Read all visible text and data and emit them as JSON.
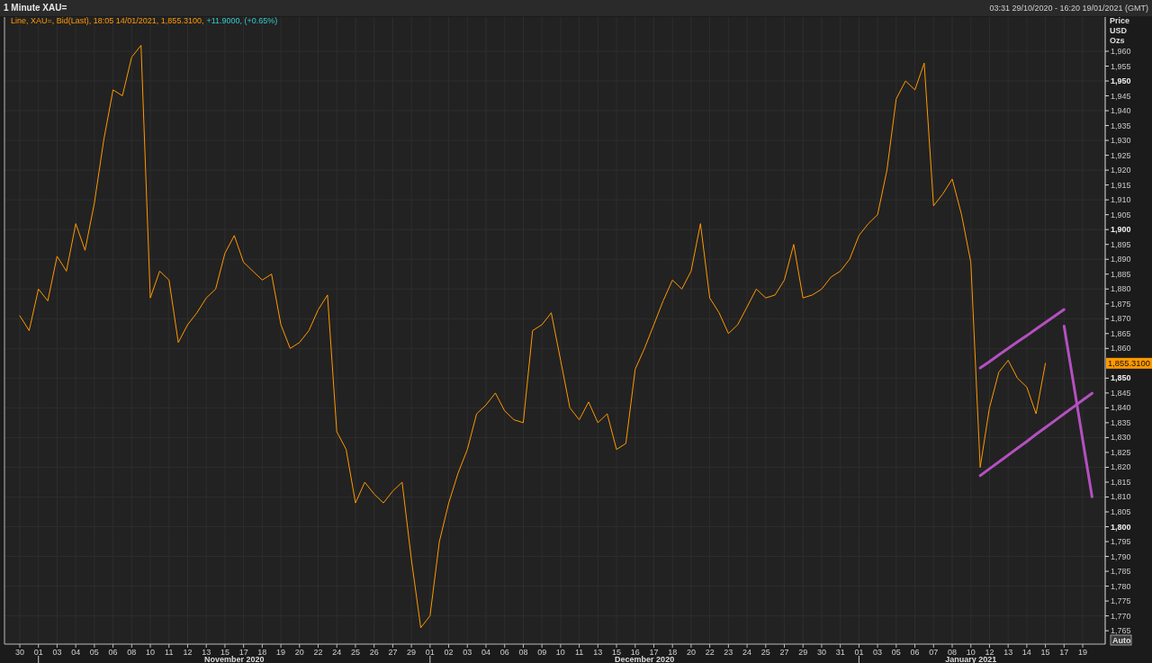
{
  "window": {
    "title": "1 Minute XAU=",
    "range": "03:31 29/10/2020 - 16:20 19/01/2021 (GMT)"
  },
  "chart": {
    "legend": {
      "text": "Line, XAU=, Bid(Last), 18:05 14/01/2021, 1,855.3100,",
      "change": "+11.9000, (+0.65%)"
    },
    "axis_header": [
      "Price",
      "USD",
      "Ozs"
    ],
    "last_price_tag": "1,855.3100",
    "months": [
      "November 2020",
      "December 2020",
      "January 2021"
    ],
    "auto_button": "Auto",
    "chart_data": {
      "type": "line",
      "ylim": [
        1760.5,
        1971.5
      ],
      "grid": true,
      "categories": [
        "30",
        null,
        "01",
        null,
        "03",
        null,
        "04",
        null,
        "05",
        null,
        "06",
        null,
        "08",
        null,
        "10",
        null,
        "11",
        null,
        "12",
        null,
        "13",
        null,
        "15",
        null,
        "17",
        null,
        "18",
        null,
        "19",
        null,
        "20",
        null,
        "22",
        null,
        "24",
        null,
        "25",
        null,
        "26",
        null,
        "27",
        null,
        "29",
        null,
        "01",
        null,
        "02",
        null,
        "03",
        null,
        "04",
        null,
        "06",
        null,
        "08",
        null,
        "09",
        null,
        "10",
        null,
        "11",
        null,
        "13",
        null,
        "15",
        null,
        "16",
        null,
        "17",
        null,
        "18",
        null,
        "20",
        null,
        "22",
        null,
        "23",
        null,
        "24",
        null,
        "25",
        null,
        "27",
        null,
        "29",
        null,
        "30",
        null,
        "31",
        null,
        "01",
        null,
        "03",
        null,
        "05",
        null,
        "06",
        null,
        "07",
        null,
        "08",
        null,
        "10",
        null,
        "12",
        null,
        "13",
        null,
        "14",
        null,
        "15",
        null,
        "17",
        null,
        "19",
        null
      ],
      "series": [
        {
          "color": "#ff9900",
          "values": [
            1871,
            1866,
            1880,
            1876,
            1891,
            1886,
            1902,
            1893,
            1909,
            1930,
            1947,
            1945,
            1958,
            1962,
            1877,
            1886,
            1883,
            1862,
            1868,
            1872,
            1877,
            1880,
            1892,
            1898,
            1889,
            1886,
            1883,
            1885,
            1868,
            1860,
            1862,
            1866,
            1873,
            1878,
            1832,
            1826,
            1808,
            1815,
            1811,
            1808,
            1812,
            1815,
            1789,
            1766,
            1770,
            1795,
            1808,
            1818,
            1826,
            1838,
            1841,
            1845,
            1839,
            1836,
            1835,
            1866,
            1868,
            1872,
            1856,
            1840,
            1836,
            1842,
            1835,
            1838,
            1826,
            1828,
            1853,
            1860,
            1868,
            1876,
            1883,
            1880,
            1886,
            1902,
            1877,
            1872,
            1865,
            1868,
            1874,
            1880,
            1877,
            1878,
            1883,
            1895,
            1877,
            1878,
            1880,
            1884,
            1886,
            1890,
            1898,
            1902,
            1905,
            1920,
            1944,
            1950,
            1947,
            1956,
            1908,
            1912,
            1917,
            1905,
            1889,
            1820,
            1840,
            1852,
            1856,
            1850,
            1847,
            1838,
            1855,
            null,
            null,
            null,
            null,
            null
          ]
        },
        {
          "color": "#b450c0",
          "values": [
            null,
            null,
            null,
            null,
            null,
            null,
            null,
            null,
            null,
            null,
            null,
            null,
            null,
            null,
            null,
            null,
            null,
            null,
            null,
            null,
            null,
            null,
            null,
            null,
            null,
            null,
            null,
            null,
            null,
            null,
            null,
            null,
            null,
            null,
            null,
            null,
            null,
            null,
            null,
            null,
            null,
            null,
            null,
            null,
            null,
            null,
            null,
            null,
            null,
            null,
            null,
            null,
            null,
            null,
            null,
            null,
            null,
            null,
            null,
            null,
            null,
            null,
            null,
            null,
            null,
            null,
            null,
            null,
            null,
            null,
            null,
            null,
            null,
            null,
            null,
            null,
            null,
            null,
            null,
            null,
            null,
            null,
            null,
            null,
            null,
            null,
            null,
            null,
            null,
            null,
            null,
            null,
            null,
            null,
            null,
            null,
            null,
            null,
            null,
            null,
            null,
            null,
            null,
            1853.4,
            1855.6,
            1857.8,
            1860.0,
            1862.2,
            1864.3,
            1866.5,
            1868.7,
            1870.9,
            1873.1,
            null,
            null,
            null
          ]
        },
        {
          "color": "#b450c0",
          "values": [
            null,
            null,
            null,
            null,
            null,
            null,
            null,
            null,
            null,
            null,
            null,
            null,
            null,
            null,
            null,
            null,
            null,
            null,
            null,
            null,
            null,
            null,
            null,
            null,
            null,
            null,
            null,
            null,
            null,
            null,
            null,
            null,
            null,
            null,
            null,
            null,
            null,
            null,
            null,
            null,
            null,
            null,
            null,
            null,
            null,
            null,
            null,
            null,
            null,
            null,
            null,
            null,
            null,
            null,
            null,
            null,
            null,
            null,
            null,
            null,
            null,
            null,
            null,
            null,
            null,
            null,
            null,
            null,
            null,
            null,
            null,
            null,
            null,
            null,
            null,
            null,
            null,
            null,
            null,
            null,
            null,
            null,
            null,
            null,
            null,
            null,
            null,
            null,
            null,
            null,
            null,
            null,
            null,
            null,
            null,
            null,
            null,
            null,
            null,
            null,
            null,
            null,
            null,
            1817.2,
            1819.5,
            1821.8,
            1824.1,
            1826.4,
            1828.7,
            1831.1,
            1833.4,
            1835.7,
            1838.0,
            1840.3,
            1842.6,
            1844.9
          ]
        },
        {
          "color": "#b450c0",
          "values": [
            null,
            null,
            null,
            null,
            null,
            null,
            null,
            null,
            null,
            null,
            null,
            null,
            null,
            null,
            null,
            null,
            null,
            null,
            null,
            null,
            null,
            null,
            null,
            null,
            null,
            null,
            null,
            null,
            null,
            null,
            null,
            null,
            null,
            null,
            null,
            null,
            null,
            null,
            null,
            null,
            null,
            null,
            null,
            null,
            null,
            null,
            null,
            null,
            null,
            null,
            null,
            null,
            null,
            null,
            null,
            null,
            null,
            null,
            null,
            null,
            null,
            null,
            null,
            null,
            null,
            null,
            null,
            null,
            null,
            null,
            null,
            null,
            null,
            null,
            null,
            null,
            null,
            null,
            null,
            null,
            null,
            null,
            null,
            null,
            null,
            null,
            null,
            null,
            null,
            null,
            null,
            null,
            null,
            null,
            null,
            null,
            null,
            null,
            null,
            null,
            null,
            null,
            null,
            null,
            null,
            null,
            null,
            null,
            null,
            null,
            null,
            null,
            1867.5,
            1848.4,
            1829.2,
            1810.1
          ]
        }
      ],
      "yticks": [
        {
          "value": 1765,
          "label": "1,765"
        },
        {
          "value": 1770,
          "label": "1,770"
        },
        {
          "value": 1775,
          "label": "1,775"
        },
        {
          "value": 1780,
          "label": "1,780"
        },
        {
          "value": 1785,
          "label": "1,785"
        },
        {
          "value": 1790,
          "label": "1,790"
        },
        {
          "value": 1795,
          "label": "1,795"
        },
        {
          "value": 1800,
          "label": "1,800"
        },
        {
          "value": 1805,
          "label": "1,805"
        },
        {
          "value": 1810,
          "label": "1,810"
        },
        {
          "value": 1815,
          "label": "1,815"
        },
        {
          "value": 1820,
          "label": "1,820"
        },
        {
          "value": 1825,
          "label": "1,825"
        },
        {
          "value": 1830,
          "label": "1,830"
        },
        {
          "value": 1835,
          "label": "1,835"
        },
        {
          "value": 1840,
          "label": "1,840"
        },
        {
          "value": 1845,
          "label": "1,845"
        },
        {
          "value": 1850,
          "label": "1,850"
        },
        {
          "value": 1860,
          "label": "1,860"
        },
        {
          "value": 1865,
          "label": "1,865"
        },
        {
          "value": 1870,
          "label": "1,870"
        },
        {
          "value": 1875,
          "label": "1,875"
        },
        {
          "value": 1880,
          "label": "1,880"
        },
        {
          "value": 1885,
          "label": "1,885"
        },
        {
          "value": 1890,
          "label": "1,890"
        },
        {
          "value": 1895,
          "label": "1,895"
        },
        {
          "value": 1900,
          "label": "1,900"
        },
        {
          "value": 1905,
          "label": "1,905"
        },
        {
          "value": 1910,
          "label": "1,910"
        },
        {
          "value": 1915,
          "label": "1,915"
        },
        {
          "value": 1920,
          "label": "1,920"
        },
        {
          "value": 1925,
          "label": "1,925"
        },
        {
          "value": 1930,
          "label": "1,930"
        },
        {
          "value": 1935,
          "label": "1,935"
        },
        {
          "value": 1940,
          "label": "1,940"
        },
        {
          "value": 1945,
          "label": "1,945"
        },
        {
          "value": 1950,
          "label": "1,950"
        },
        {
          "value": 1955,
          "label": "1,955"
        },
        {
          "value": 1960,
          "label": "1,960"
        }
      ]
    }
  }
}
